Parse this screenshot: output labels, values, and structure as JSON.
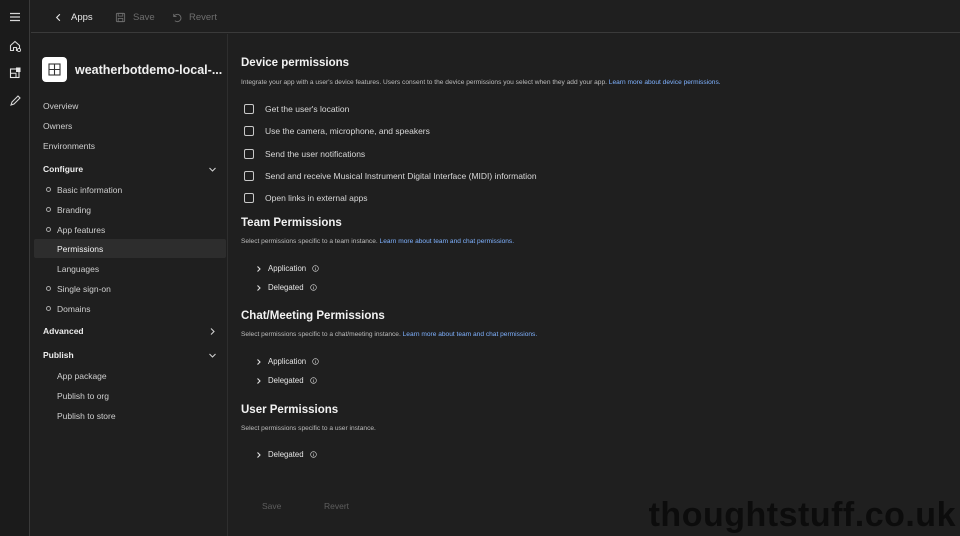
{
  "rail": {
    "items": [
      {
        "icon": "menu-icon"
      },
      {
        "icon": "home-icon"
      },
      {
        "icon": "apps-icon"
      },
      {
        "icon": "pencil-icon"
      }
    ]
  },
  "topbar": {
    "back_label": "Apps",
    "save_label": "Save",
    "revert_label": "Revert"
  },
  "app": {
    "name": "weatherbotdemo-local-..."
  },
  "sidebar": {
    "overview": "Overview",
    "owners": "Owners",
    "environments": "Environments",
    "configure": {
      "label": "Configure",
      "items": [
        {
          "label": "Basic information"
        },
        {
          "label": "Branding"
        },
        {
          "label": "App features"
        },
        {
          "label": "Permissions"
        },
        {
          "label": "Languages"
        },
        {
          "label": "Single sign-on"
        },
        {
          "label": "Domains"
        }
      ]
    },
    "advanced": {
      "label": "Advanced"
    },
    "publish": {
      "label": "Publish",
      "items": [
        {
          "label": "App package"
        },
        {
          "label": "Publish to org"
        },
        {
          "label": "Publish to store"
        }
      ]
    }
  },
  "device": {
    "title": "Device permissions",
    "desc": "Integrate your app with a user's device features. Users consent to the device permissions you select when they add your app.",
    "link": "Learn more about device permissions.",
    "options": [
      {
        "label": "Get the user's location"
      },
      {
        "label": "Use the camera, microphone, and speakers"
      },
      {
        "label": "Send the user notifications"
      },
      {
        "label": "Send and receive Musical Instrument Digital Interface (MIDI) information"
      },
      {
        "label": "Open links in external apps"
      }
    ]
  },
  "team": {
    "title": "Team Permissions",
    "desc": "Select permissions specific to a team instance.",
    "link": "Learn more about team and chat permissions.",
    "application": "Application",
    "delegated": "Delegated"
  },
  "chat": {
    "title": "Chat/Meeting Permissions",
    "desc": "Select permissions specific to a chat/meeting instance.",
    "link": "Learn more about team and chat permissions.",
    "application": "Application",
    "delegated": "Delegated"
  },
  "user": {
    "title": "User Permissions",
    "desc": "Select permissions specific to a user instance.",
    "delegated": "Delegated"
  },
  "footer": {
    "save_label": "Save",
    "revert_label": "Revert"
  },
  "watermark": "thoughtstuff.co.uk"
}
